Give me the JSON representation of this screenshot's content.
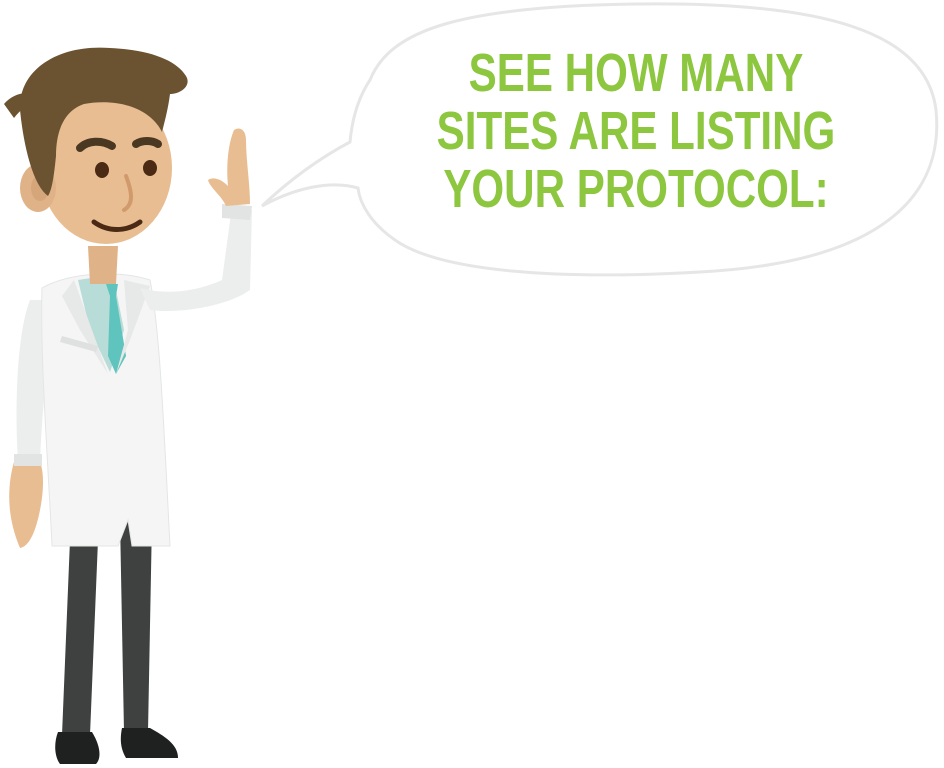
{
  "speech_bubble": {
    "lines": [
      "SEE HOW MANY",
      "SITES ARE LISTING",
      "YOUR PROTOCOL:"
    ]
  },
  "colors": {
    "headline_text": "#8dc63f",
    "bubble_fill": "#ffffff",
    "bubble_outline": "#e6e6e6",
    "hair": "#6b5332",
    "skin": "#e8bd92",
    "lab_coat": "#f4f5f4",
    "shirt": "#b8dcd8",
    "tie": "#5fc4bd",
    "trousers": "#3f4140",
    "shoes": "#1f2120"
  },
  "illustration": {
    "character": "doctor-waving-icon"
  }
}
